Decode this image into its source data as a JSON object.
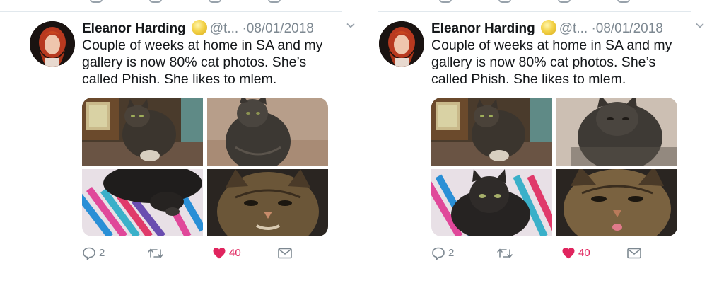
{
  "colors": {
    "name": "#14171a",
    "meta": "#7d8891",
    "like": "#e0245e",
    "icon": "#7d8891",
    "divider": "#e1e8ed"
  },
  "tweets": [
    {
      "author": "Eleanor Harding",
      "handle": "@t...",
      "separator": "·",
      "date": "08/01/2018",
      "text": "Couple of weeks at home in SA and my gallery is now 80% cat photos. She’s called Phish. She likes to mlem.",
      "photos": [
        "cat-by-window",
        "cat-sitting-grey",
        "cat-lying-striped-blanket",
        "cat-closeup-face"
      ],
      "actions": {
        "replies": "2",
        "retweets": "",
        "likes": "40"
      },
      "icons": [
        "reply-icon",
        "retweet-icon",
        "heart-icon",
        "message-icon"
      ]
    },
    {
      "author": "Eleanor Harding",
      "handle": "@t...",
      "separator": "·",
      "date": "08/01/2018",
      "text": "Couple of weeks at home in SA and my gallery is now 80% cat photos. She’s called Phish. She likes to mlem.",
      "photos": [
        "cat-by-window",
        "cat-closeup-grey",
        "cat-on-striped-blanket",
        "cat-face-mlem"
      ],
      "actions": {
        "replies": "2",
        "retweets": "",
        "likes": "40"
      },
      "icons": [
        "reply-icon",
        "retweet-icon",
        "heart-icon",
        "message-icon"
      ]
    }
  ]
}
